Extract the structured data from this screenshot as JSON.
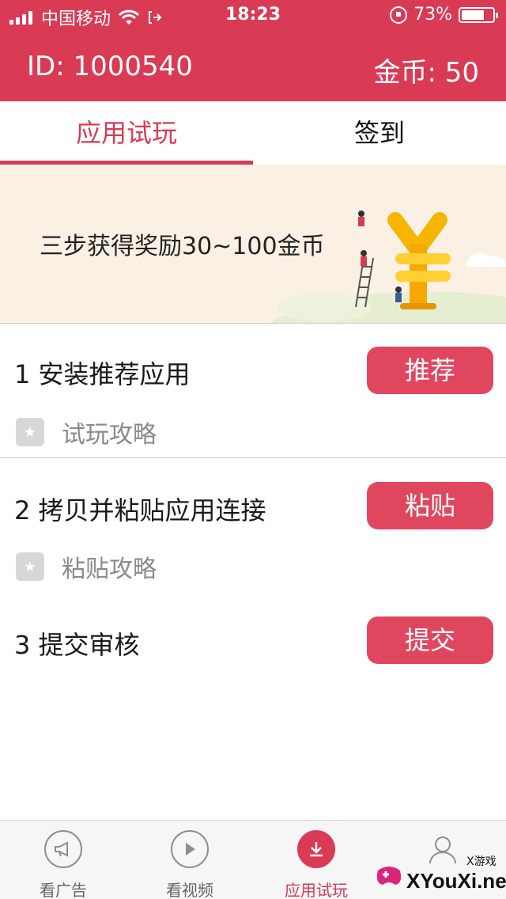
{
  "status_bar": {
    "carrier": "中国移动",
    "time": "18:23",
    "battery": "73%",
    "battery_level": 0.73
  },
  "header": {
    "id_text": "ID: 1000540",
    "coins_text": "金币: 50"
  },
  "tabs": [
    {
      "label": "应用试玩",
      "active": true
    },
    {
      "label": "签到",
      "active": false
    }
  ],
  "banner": {
    "text": "三步获得奖励30~100金币"
  },
  "steps": [
    {
      "label": "1 安装推荐应用",
      "button": "推荐",
      "guide": "试玩攻略"
    },
    {
      "label": "2 拷贝并粘贴应用连接",
      "button": "粘贴",
      "guide": "粘贴攻略"
    },
    {
      "label": "3 提交审核",
      "button": "提交"
    }
  ],
  "bottom_nav": [
    {
      "label": "看广告",
      "icon": "megaphone-icon",
      "active": false
    },
    {
      "label": "看视频",
      "icon": "play-icon",
      "active": false
    },
    {
      "label": "应用试玩",
      "icon": "download-icon",
      "active": true
    },
    {
      "label": "",
      "icon": "user-icon",
      "active": false
    }
  ],
  "watermark": {
    "brand": "XYouXi.net",
    "small": "X游戏"
  },
  "colors": {
    "primary": "#d93a54",
    "button": "#e0475f",
    "banner_bg": "#faf1e4"
  }
}
